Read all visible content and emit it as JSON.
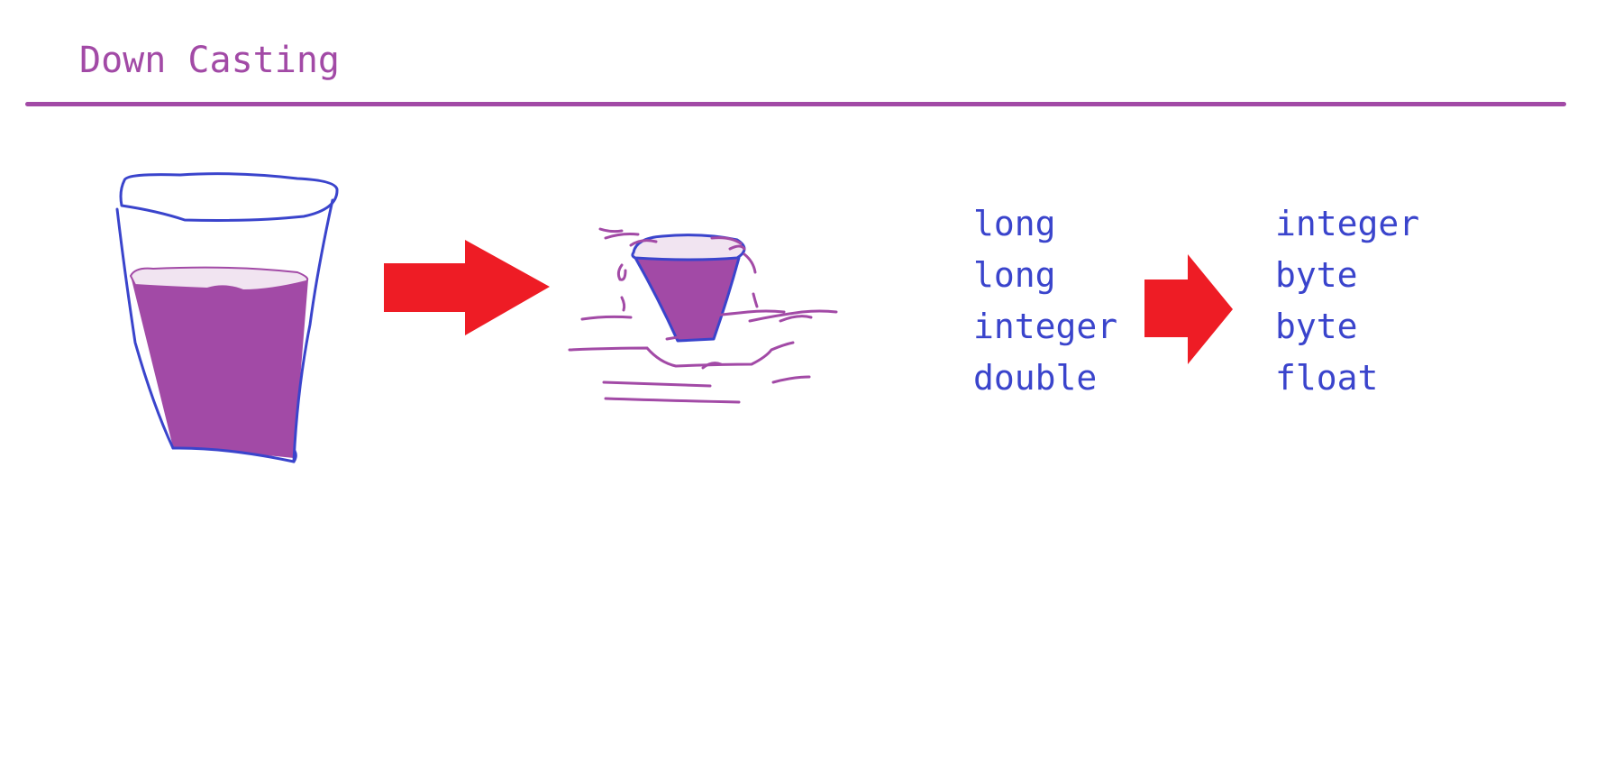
{
  "title": "Down Casting",
  "colors": {
    "title": "#a24aa6",
    "outline": "#3a44cc",
    "liquid": "#a24aa6",
    "liquid_surface": "#f1e4f1",
    "arrow": "#ee1c25",
    "text": "#3a44cc"
  },
  "illustration": {
    "large_cup": "large cup filled with purple liquid",
    "arrow_1": "right-arrow-icon",
    "small_cup": "small cup overflowing with spilled liquid"
  },
  "conversions": {
    "from_types": [
      "long",
      "long",
      "integer",
      "double"
    ],
    "arrow_2": "right-arrow-icon",
    "to_types": [
      "integer",
      "byte",
      "byte",
      "float"
    ]
  }
}
